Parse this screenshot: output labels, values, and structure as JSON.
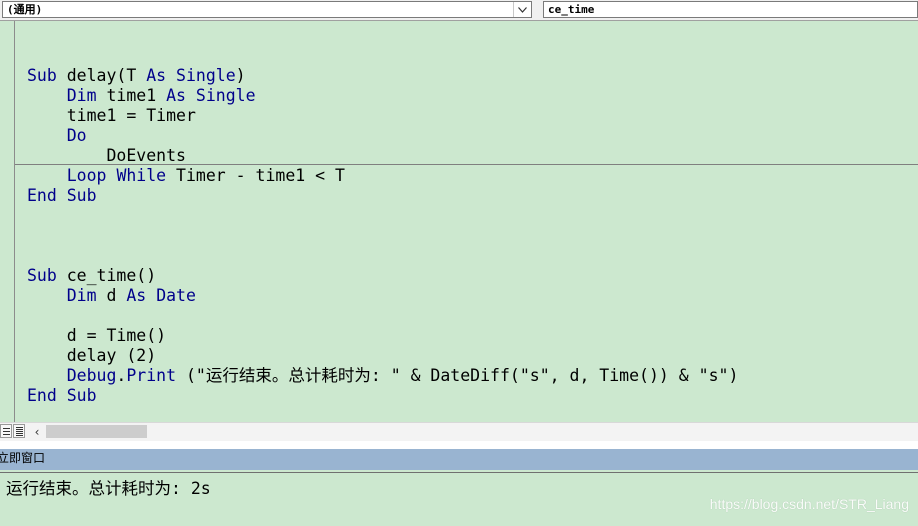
{
  "object_combo": {
    "value": "(通用)"
  },
  "procedure_combo": {
    "value": "ce_time"
  },
  "code": {
    "delay": [
      [
        {
          "t": "Sub",
          "k": 1
        },
        {
          "t": " delay(T "
        },
        {
          "t": "As",
          "k": 1
        },
        {
          "t": " "
        },
        {
          "t": "Single",
          "k": 1
        },
        {
          "t": ")"
        }
      ],
      [
        {
          "t": "    "
        },
        {
          "t": "Dim",
          "k": 1
        },
        {
          "t": " time1 "
        },
        {
          "t": "As",
          "k": 1
        },
        {
          "t": " "
        },
        {
          "t": "Single",
          "k": 1
        }
      ],
      [
        {
          "t": "    time1 = Timer"
        }
      ],
      [
        {
          "t": "    "
        },
        {
          "t": "Do",
          "k": 1
        }
      ],
      [
        {
          "t": "        DoEvents"
        }
      ],
      [
        {
          "t": "    "
        },
        {
          "t": "Loop",
          "k": 1
        },
        {
          "t": " "
        },
        {
          "t": "While",
          "k": 1
        },
        {
          "t": " Timer - time1 < T"
        }
      ],
      [
        {
          "t": "End",
          "k": 1
        },
        {
          "t": " "
        },
        {
          "t": "Sub",
          "k": 1
        }
      ]
    ],
    "ce_time": [
      [
        {
          "t": ""
        }
      ],
      [
        {
          "t": "Sub",
          "k": 1
        },
        {
          "t": " ce_time()"
        }
      ],
      [
        {
          "t": "    "
        },
        {
          "t": "Dim",
          "k": 1
        },
        {
          "t": " d "
        },
        {
          "t": "As",
          "k": 1
        },
        {
          "t": " "
        },
        {
          "t": "Date",
          "k": 1
        }
      ],
      [
        {
          "t": ""
        }
      ],
      [
        {
          "t": "    d = Time()"
        }
      ],
      [
        {
          "t": "    delay (2)"
        }
      ],
      [
        {
          "t": "    "
        },
        {
          "t": "Debug",
          "k": 1
        },
        {
          "t": "."
        },
        {
          "t": "Print",
          "k": 1
        },
        {
          "t": " (\"运行结束。总计耗时为: \" & DateDiff(\"s\", d, Time()) & \"s\")"
        }
      ],
      [
        {
          "t": "End",
          "k": 1
        },
        {
          "t": " "
        },
        {
          "t": "Sub",
          "k": 1
        }
      ]
    ]
  },
  "immediate_window": {
    "title": "立即窗口",
    "output": "运行结束。总计耗时为: 2s"
  },
  "watermark": "https://blog.csdn.net/STR_Liang",
  "colors": {
    "editor_background": "#cce8cf",
    "keyword": "#00008b",
    "title_bar": "#99b4d1"
  },
  "icons": {
    "combo_arrow": "chevron-down-icon",
    "scroll_left": "arrow-left-icon",
    "procedure_view": "procedure-view-icon",
    "full_module_view": "full-module-view-icon"
  }
}
